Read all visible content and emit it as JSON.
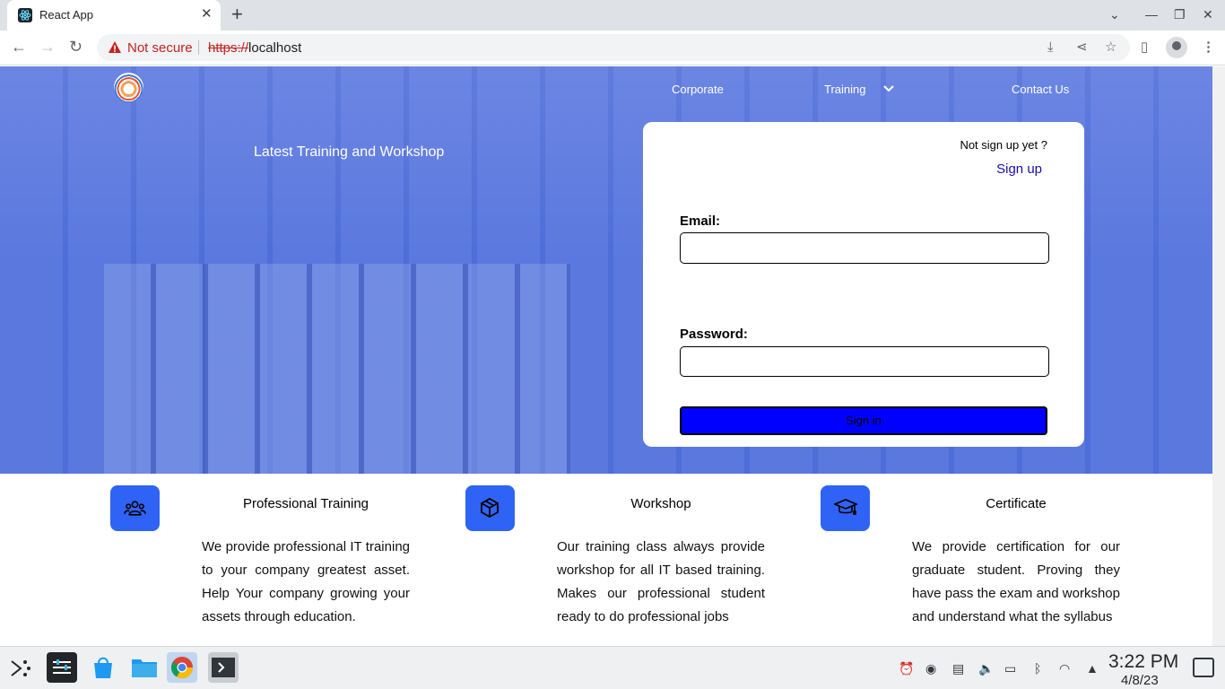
{
  "browser": {
    "tab_title": "React App",
    "tab_close": "✕",
    "new_tab": "+",
    "security_label": "Not secure",
    "url_scheme": "https://",
    "url_host": "localhost"
  },
  "site": {
    "nav": {
      "items": [
        {
          "label": "Corporate"
        },
        {
          "label": "Training"
        },
        {
          "label": "Contact Us"
        }
      ]
    },
    "hero": {
      "headline": "Latest Training and Workshop"
    },
    "login": {
      "signup_prompt": "Not sign up yet ?",
      "signup_link": "Sign up",
      "email_label": "Email:",
      "email_value": "",
      "password_label": "Password:",
      "password_value": "",
      "signin_label": "Sign in"
    },
    "features": [
      {
        "icon": "people-group-icon",
        "title": "Professional Training",
        "text": "We provide professional IT training to your company greatest asset. Help Your company growing your assets through education."
      },
      {
        "icon": "cube-icon",
        "title": "Workshop",
        "text": "Our training class always provide workshop for all IT based training. Makes our professional student ready to do professional jobs"
      },
      {
        "icon": "graduation-cap-icon",
        "title": "Certificate",
        "text": "We provide certification for our graduate student. Proving they have pass the exam and workshop and understand what the syllabus"
      }
    ],
    "colors": {
      "hero_overlay": "#3e60dc",
      "feature_icon_bg": "#2f63f5",
      "signin_button": "#0000ff",
      "link": "#1a0dab"
    }
  },
  "taskbar": {
    "clock_time": "3:22 PM",
    "clock_date": "4/8/23"
  }
}
